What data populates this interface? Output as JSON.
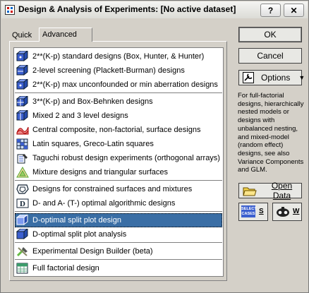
{
  "window": {
    "title": "Design & Analysis of Experiments: [No active dataset]",
    "help_label": "?",
    "close_label": "✕"
  },
  "tabs": [
    {
      "label": "Quick"
    },
    {
      "label": "Advanced"
    }
  ],
  "list": {
    "items": [
      {
        "label": "2**(K-p) standard designs (Box, Hunter, & Hunter)",
        "icon": "factorial-cube-icon"
      },
      {
        "label": "2-level screening (Plackett-Burman) designs",
        "icon": "screening-icon"
      },
      {
        "label": "2**(K-p) max unconfounded or min aberration designs",
        "icon": "factorial-cube-icon"
      },
      {
        "label": "3**(K-p) and Box-Behnken designs",
        "icon": "three-level-icon"
      },
      {
        "label": "Mixed 2 and 3 level designs",
        "icon": "mixed-level-icon"
      },
      {
        "label": "Central composite, non-factorial, surface designs",
        "icon": "surface-icon"
      },
      {
        "label": "Latin squares, Greco-Latin squares",
        "icon": "latin-square-icon"
      },
      {
        "label": "Taguchi robust design experiments (orthogonal arrays)",
        "icon": "taguchi-icon"
      },
      {
        "label": "Mixture designs and triangular surfaces",
        "icon": "mixture-icon"
      },
      {
        "label": "Designs for constrained surfaces and mixtures",
        "icon": "constrained-icon"
      },
      {
        "label": "D- and A- (T-) optimal algorithmic designs",
        "icon": "d-optimal-icon"
      },
      {
        "label": "D-optimal split plot design",
        "icon": "split-plot-icon",
        "selected": true
      },
      {
        "label": "D-optimal split plot analysis",
        "icon": "split-plot-icon"
      },
      {
        "label": "Experimental Design Builder (beta)",
        "icon": "builder-tools-icon"
      },
      {
        "label": "Full factorial design",
        "icon": "full-factorial-icon"
      }
    ]
  },
  "buttons": {
    "ok": "OK",
    "cancel": "Cancel",
    "options": "Options",
    "open_data": "Open Data",
    "select_cases_top": "SELECT",
    "select_cases_bottom": "CASES",
    "select_cases_key": "S",
    "weights_key": "W"
  },
  "help_text": "For full-factorial designs, hierarchically nested models or designs with unbalanced nesting, and mixed-model (random effect) designs, see also Variance Components and GLM."
}
